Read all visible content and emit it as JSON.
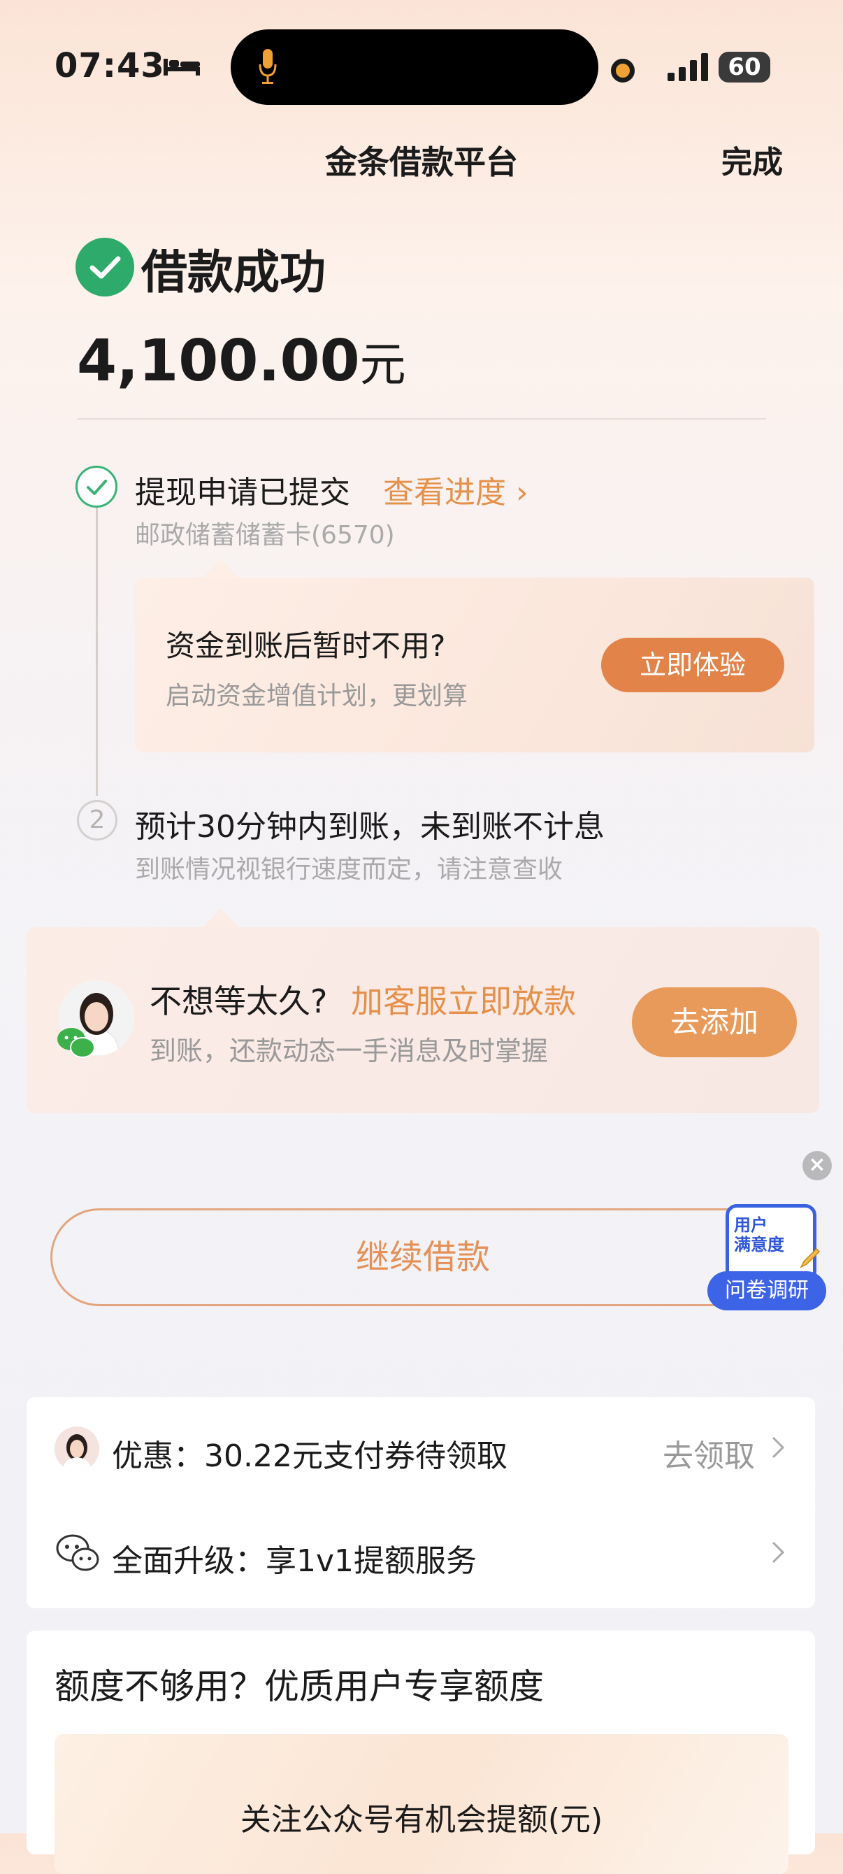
{
  "status_bar": {
    "time": "07:43",
    "battery": "60"
  },
  "nav": {
    "title": "金条借款平台",
    "done": "完成"
  },
  "result": {
    "title": "借款成功",
    "amount": "4,100.00",
    "unit": "元"
  },
  "steps": {
    "step1": {
      "title": "提现申请已提交",
      "link": "查看进度",
      "bank": "邮政储蓄储蓄卡(6570)"
    },
    "promo": {
      "title": "资金到账后暂时不用?",
      "subtitle": "启动资金增值计划，更划算",
      "button": "立即体验"
    },
    "step2": {
      "number": "2",
      "title": "预计30分钟内到账，未到账不计息",
      "subtitle": "到账情况视银行速度而定，请注意查收"
    }
  },
  "service_card": {
    "question": "不想等太久?",
    "highlight": "加客服立即放款",
    "subtitle": "到账，还款动态一手消息及时掌握",
    "button": "去添加"
  },
  "continue_button": "继续借款",
  "survey": {
    "top_line1": "用户",
    "top_line2": "满意度",
    "label": "问卷调研"
  },
  "list": [
    {
      "label": "优惠：30.22元支付券待领取",
      "action": "去领取"
    },
    {
      "label": "全面升级：享1v1提额服务",
      "action": ""
    }
  ],
  "quota": {
    "title": "额度不够用？优质用户专享额度",
    "banner_text": "关注公众号有机会提额(元)"
  },
  "colors": {
    "accent": "#e5914b",
    "success": "#2eaa6a",
    "survey_blue": "#3d63e6"
  }
}
